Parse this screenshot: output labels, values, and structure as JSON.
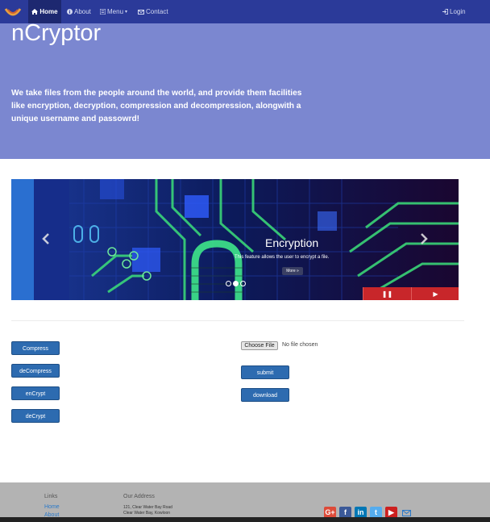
{
  "navbar": {
    "brand_icon": "ncryptor-logo-icon",
    "items": [
      {
        "label": "Home",
        "icon": "home-icon",
        "active": true
      },
      {
        "label": "About",
        "icon": "info-icon",
        "active": false
      },
      {
        "label": "Menu",
        "icon": "list-icon",
        "active": false
      },
      {
        "label": "Contact",
        "icon": "envelope-icon",
        "active": false
      }
    ],
    "login_label": "Login",
    "login_icon": "login-icon",
    "color": "#2b3a99"
  },
  "hero": {
    "title": "nCryptor",
    "description": "We take files from the people around the world, and provide them facilities like encryption, decryption, compression and decompression, alongwith a unique username and passowrd!",
    "color": "#7b87d0"
  },
  "carousel": {
    "slide_title": "Encryption",
    "slide_text": "This feature allows the user to encrypt a file.",
    "more_label": "More »",
    "prev_icon": "chevron-left-icon",
    "next_icon": "chevron-right-icon",
    "indicators": 3,
    "active_indicator": 1,
    "pause_icon": "pause-icon",
    "play_icon": "play-icon",
    "control_color": "#c8262a"
  },
  "actions": {
    "compress_label": "Compress",
    "decompress_label": "deCompress",
    "encrypt_label": "enCrypt",
    "decrypt_label": "deCrypt",
    "button_color": "#2d6bb0"
  },
  "upload": {
    "choose_label": "Choose File",
    "status": "No file chosen",
    "submit_label": "submit",
    "download_label": "download"
  },
  "footer": {
    "links_heading": "Links",
    "links": [
      "Home",
      "About"
    ],
    "address_heading": "Our Address",
    "address_lines": [
      "121, Clear Water Bay Road",
      "Clear Water Bay, Kowloon"
    ],
    "social": [
      {
        "name": "google-plus-icon",
        "glyph": "G+",
        "color": "#dd4b39"
      },
      {
        "name": "facebook-icon",
        "glyph": "f",
        "color": "#3b5998"
      },
      {
        "name": "linkedin-icon",
        "glyph": "in",
        "color": "#0077b5"
      },
      {
        "name": "twitter-icon",
        "glyph": "t",
        "color": "#55acee"
      },
      {
        "name": "youtube-icon",
        "glyph": "▶",
        "color": "#cd201f"
      }
    ],
    "mail_icon": "mail-icon"
  }
}
